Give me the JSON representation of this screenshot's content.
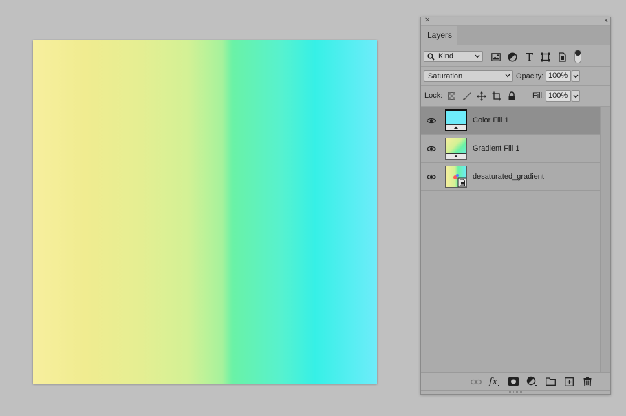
{
  "canvas": {
    "gradient_colors": [
      "#f7ef9e",
      "#f0ec90",
      "#e6ee92",
      "#d3f195",
      "#a6f29c",
      "#6af2a6",
      "#57f2ce",
      "#36f0e6",
      "#6eecfa"
    ]
  },
  "panel": {
    "tab_label": "Layers",
    "filter": {
      "kind_label": "Kind",
      "icons": [
        "pixel-layer-filter-icon",
        "adjustment-layer-filter-icon",
        "type-layer-filter-icon",
        "shape-layer-filter-icon",
        "smart-object-filter-icon"
      ]
    },
    "blend_mode": "Saturation",
    "opacity_label": "Opacity:",
    "opacity_value": "100%",
    "lock_label": "Lock:",
    "fill_label": "Fill:",
    "fill_value": "100%",
    "layers": [
      {
        "name": "Color Fill 1",
        "selected": true,
        "visible": true,
        "thumb_color": "#6eecfa"
      },
      {
        "name": "Gradient Fill 1",
        "selected": false,
        "visible": true
      },
      {
        "name": "desaturated_gradient",
        "selected": false,
        "visible": true
      }
    ],
    "footer_icons": [
      "link-layers-icon",
      "fx-icon",
      "layer-mask-icon",
      "adjustment-layer-icon",
      "new-group-icon",
      "new-layer-icon",
      "delete-layer-icon"
    ]
  }
}
